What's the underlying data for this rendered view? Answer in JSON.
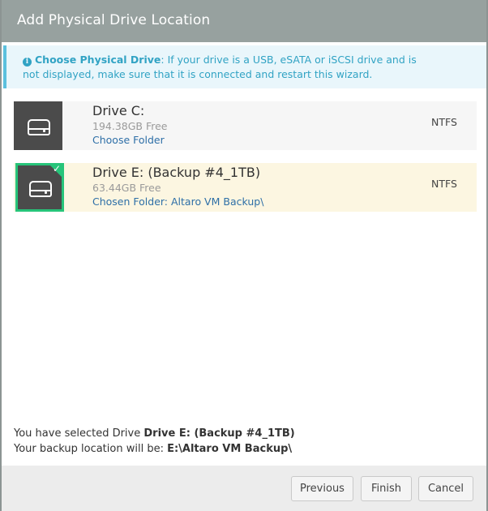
{
  "dialog": {
    "title": "Add Physical Drive Location"
  },
  "info": {
    "heading": "Choose Physical Drive",
    "message": ": If your drive is a USB, eSATA or iSCSI drive and is not displayed, make sure that it is connected and restart this wizard.",
    "icon": "info-icon",
    "color": "#31a3c4"
  },
  "drives": [
    {
      "name": "Drive C:",
      "free": "194.38GB Free",
      "link": "Choose Folder",
      "fs": "NTFS",
      "selected": false
    },
    {
      "name": "Drive E: (Backup #4_1TB)",
      "free": "63.44GB Free",
      "link": "Chosen Folder: Altaro VM Backup\\",
      "fs": "NTFS",
      "selected": true
    }
  ],
  "summary": {
    "line1_prefix": "You have selected Drive ",
    "line1_value": "Drive E: (Backup #4_1TB)",
    "line2_prefix": "Your backup location will be: ",
    "line2_value": "E:\\Altaro VM Backup\\"
  },
  "buttons": {
    "previous": "Previous",
    "finish": "Finish",
    "cancel": "Cancel"
  },
  "colors": {
    "titlebar": "#97a19f",
    "selected_border": "#27c47a",
    "selected_bg": "#fcf6e1",
    "link": "#2e6fa7"
  }
}
